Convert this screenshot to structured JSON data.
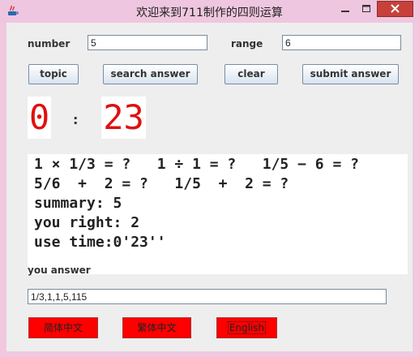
{
  "window": {
    "title": "欢迎来到711制作的四则运算",
    "title_bg": "#efc6df"
  },
  "form": {
    "number_label": "number",
    "number_value": "5",
    "range_label": "range",
    "range_value": "6"
  },
  "buttons": {
    "topic": "topic",
    "search_answer": "search answer",
    "clear": "clear",
    "submit_answer": "submit answer"
  },
  "timer": {
    "minutes": "0",
    "separator": ":",
    "seconds": "23",
    "color": "#e01010"
  },
  "result": {
    "line1": "1 × 1/3 = ?   1 ÷ 1 = ?   1/5 − 6 = ?",
    "line2": "5/6  +  2 = ?   1/5  +  2 = ?",
    "line3": "summary: 5",
    "line4": "you right: 2",
    "line5": "use time:0'23''"
  },
  "answer": {
    "label": "you answer",
    "value": "1/3,1,1,5,115"
  },
  "languages": {
    "simplified": "简体中文",
    "traditional": "繁体中文",
    "english": "English",
    "color": "#ff0000"
  }
}
